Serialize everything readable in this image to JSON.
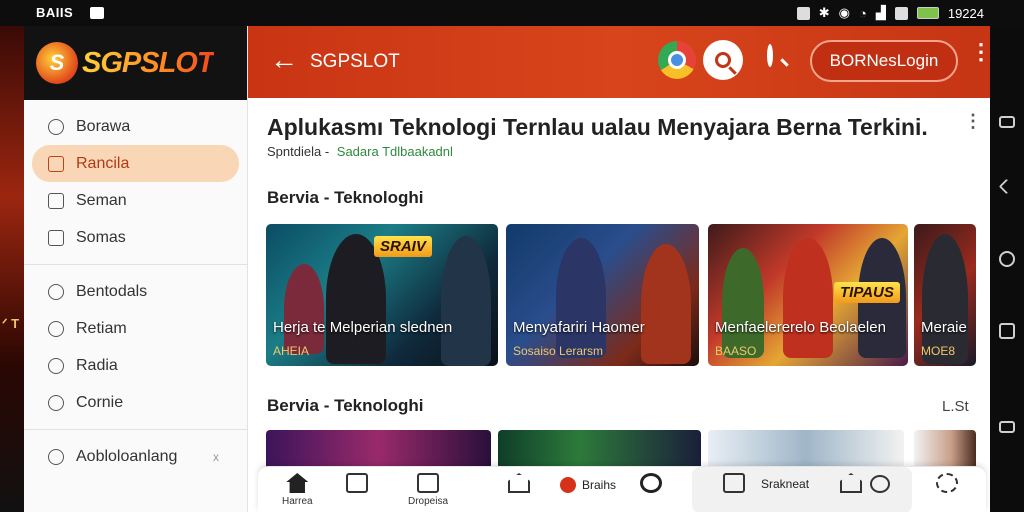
{
  "status_bar": {
    "left_text": "BAIIS",
    "time": "19224"
  },
  "brand": {
    "logo_text": "SGPSLOT",
    "logo_mark": "S"
  },
  "sidebar": {
    "groups": [
      [
        {
          "label": "Borawa",
          "icon": "search-icon"
        },
        {
          "label": "Rancila",
          "icon": "bag-icon",
          "active": true
        },
        {
          "label": "Seman",
          "icon": "square-icon"
        },
        {
          "label": "Somas",
          "icon": "square-icon"
        }
      ],
      [
        {
          "label": "Bentodals",
          "icon": "heart-icon"
        },
        {
          "label": "Retiam",
          "icon": "location-icon"
        },
        {
          "label": "Radia",
          "icon": "heart-icon"
        },
        {
          "label": "Cornie",
          "icon": "circle-icon"
        }
      ],
      [
        {
          "label": "Aobloloanlang",
          "icon": "circle-icon"
        }
      ]
    ],
    "close_symbol": "x"
  },
  "appbar": {
    "back_symbol": "←",
    "title": "SGPSLOT",
    "login_label": "BORNesLogin",
    "kebab": "⋮"
  },
  "content": {
    "headline": "Aplukasmı Teknologi Ternlau ualau Menyajara Berna Terkini.",
    "meta": "Spntdiela -",
    "meta_link": "Sadara Tdlbaakadnl",
    "section1": "Bervia - Teknologhi",
    "section2": "Bervia - Teknologhi",
    "see_all": "L.St",
    "cards": [
      {
        "caption": "Herja te Melperian slednen",
        "sub": "AHEIA",
        "badge": "SRAIV"
      },
      {
        "caption": "Menyafariri Haomer",
        "sub": "Sosaiso Lerarsm",
        "badge": ""
      },
      {
        "caption": "Menfaelererelo Beolaelen",
        "sub": "BAASO",
        "badge": "TIPAUS"
      },
      {
        "caption": "Meraie",
        "sub": "MOE8",
        "badge": ""
      }
    ]
  },
  "bottom_nav": {
    "items": [
      {
        "label": "Harrea"
      },
      {
        "label": ""
      },
      {
        "label": "Dropeisa"
      },
      {
        "label": ""
      }
    ],
    "red_label": "Braihs",
    "tile_label": "Srakneat"
  },
  "colors": {
    "brand_red": "#d2421a",
    "active_bg": "#f9d7b6"
  }
}
